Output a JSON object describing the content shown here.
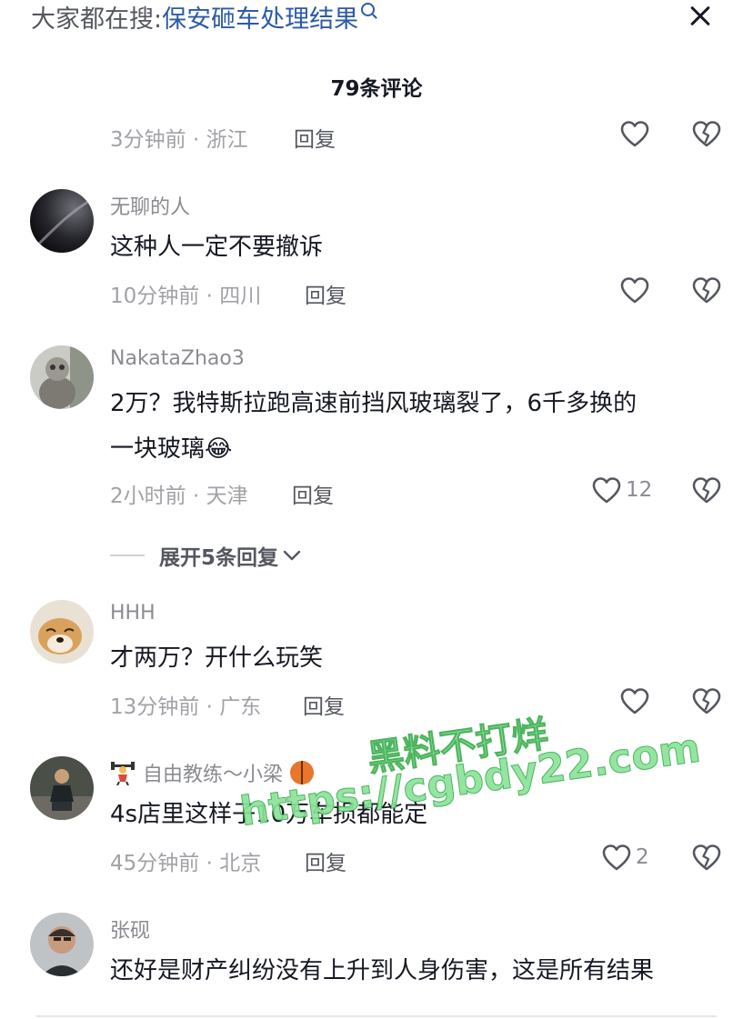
{
  "search": {
    "prefix": "大家都在搜:",
    "query": "保安砸车处理结果"
  },
  "header": {
    "count": "79条评论"
  },
  "comments": [
    {
      "username": "",
      "text": "",
      "time_location": "3分钟前 · 浙江",
      "reply": "回复",
      "likes": ""
    },
    {
      "username": "无聊的人",
      "text": "这种人一定不要撤诉",
      "time_location": "10分钟前 · 四川",
      "reply": "回复",
      "likes": ""
    },
    {
      "username": "NakataZhao3",
      "text_line1": "2万？我特斯拉跑高速前挡风玻璃裂了，6千多换的",
      "text_line2": "一块玻璃",
      "emoji": "😂",
      "time_location": "2小时前 · 天津",
      "reply": "回复",
      "likes": "12"
    },
    {
      "username": "HHH",
      "text": "才两万？开什么玩笑",
      "time_location": "13分钟前 · 广东",
      "reply": "回复",
      "likes": ""
    },
    {
      "username": "自由教练～小梁",
      "text": "4s店里这样子10万车损都能定",
      "time_location": "45分钟前 · 北京",
      "reply": "回复",
      "likes": "2"
    },
    {
      "username": "张砚",
      "text": "还好是财产纠纷没有上升到人身伤害，这是所有结果"
    }
  ],
  "expand_replies": {
    "label": "展开5条回复"
  },
  "watermark": {
    "line1": "黑料不打烊",
    "line2": "https://cgbdy22.com"
  },
  "colors": {
    "link": "#2c5aa8",
    "watermark": "#8be39a",
    "muted": "#a1a2a7"
  },
  "icons": [
    "search-icon",
    "close-icon",
    "heart-icon",
    "broken-heart-icon",
    "chevron-down-icon",
    "basketball-icon",
    "weightlifter-icon"
  ]
}
